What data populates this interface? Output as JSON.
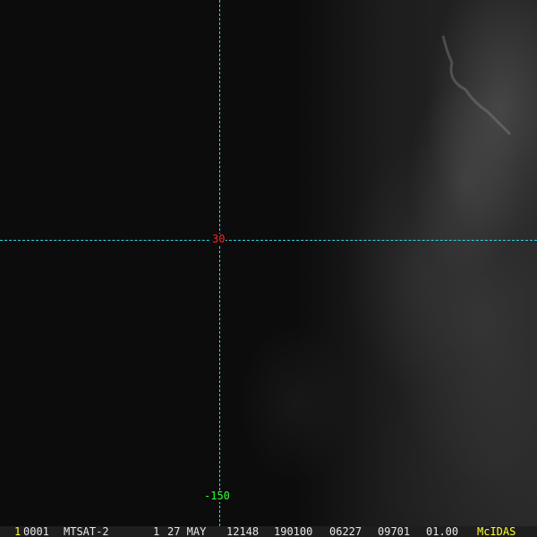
{
  "grid": {
    "latitude_label": "30",
    "longitude_label": "-150",
    "line_color": "#38d4e4"
  },
  "status_bar": {
    "frame_number": "1",
    "fields": [
      "0001",
      "MTSAT-2",
      "1",
      "27 MAY",
      "12148",
      "190100",
      "06227",
      "09701",
      "01.00"
    ],
    "software": "McIDAS"
  }
}
